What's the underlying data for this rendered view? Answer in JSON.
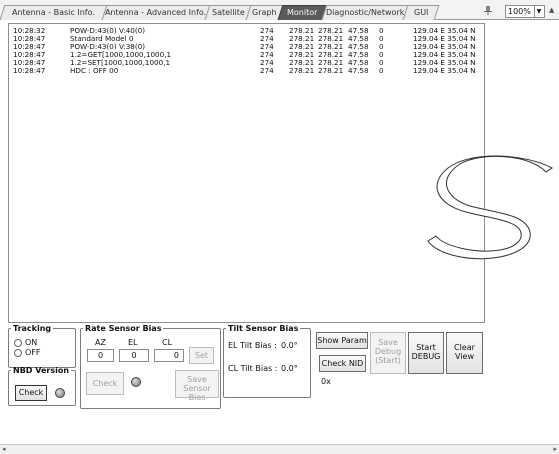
{
  "tabs": [
    {
      "label": "Antenna - Basic Info."
    },
    {
      "label": "Antenna - Advanced Info."
    },
    {
      "label": "Satellite"
    },
    {
      "label": "Graph"
    },
    {
      "label": "Monitor"
    },
    {
      "label": "Diagnostic/Network"
    },
    {
      "label": "GUI"
    }
  ],
  "active_tab": "Monitor",
  "zoom": {
    "value": "100%"
  },
  "log": [
    {
      "time": "10:28:32",
      "msg": "POW-D:43(0) V:40(0)",
      "c1": "274",
      "c2": "278.21",
      "c3": "278.21",
      "c4": "47.58",
      "c5": "0",
      "pos": "129.04 E 35.04 N"
    },
    {
      "time": "10:28:47",
      "msg": "Standard Model  0",
      "c1": "274",
      "c2": "278.21",
      "c3": "278.21",
      "c4": "47.58",
      "c5": "0",
      "pos": "129.04 E 35.04 N"
    },
    {
      "time": "10:28:47",
      "msg": "POW-D:43(0) V:38(0)",
      "c1": "274",
      "c2": "278.21",
      "c3": "278.21",
      "c4": "47.58",
      "c5": "0",
      "pos": "129.04 E 35.04 N"
    },
    {
      "time": "10:28:47",
      "msg": "1.2=GET[1000,1000,1000,1",
      "c1": "274",
      "c2": "278.21",
      "c3": "278.21",
      "c4": "47.58",
      "c5": "0",
      "pos": "129.04 E 35.04 N"
    },
    {
      "time": "10:28:47",
      "msg": "1.2=SET[1000,1000,1000,1",
      "c1": "274",
      "c2": "278.21",
      "c3": "278.21",
      "c4": "47.58",
      "c5": "0",
      "pos": "129.04 E 35.04 N"
    },
    {
      "time": "10:28:47",
      "msg": "HDC : OFF  00",
      "c1": "274",
      "c2": "278.21",
      "c3": "278.21",
      "c4": "47.58",
      "c5": "0",
      "pos": "129.04 E 35.04 N"
    }
  ],
  "tracking": {
    "title": "Tracking",
    "on": "ON",
    "off": "OFF"
  },
  "nbd": {
    "title": "NBD Version",
    "check": "Check"
  },
  "rate": {
    "title": "Rate Sensor Bias",
    "az": "AZ",
    "el": "EL",
    "cl": "CL",
    "az_val": "0",
    "el_val": "0",
    "cl_val": "0",
    "set": "Set",
    "check": "Check",
    "save_line1": "Save",
    "save_line2": "Sensor Bias"
  },
  "tilt": {
    "title": "Tilt Sensor Bias",
    "el_label": "EL Tilt Bias :",
    "el_val": "0.0°",
    "cl_label": "CL Tilt Bias :",
    "cl_val": "0.0°"
  },
  "buttons": {
    "show_param": "Show Param",
    "check_nid": "Check NID",
    "nid_value": "0x",
    "save_debug_1": "Save",
    "save_debug_2": "Debug",
    "save_debug_3": "(Start)",
    "start_debug_1": "Start",
    "start_debug_2": "DEBUG",
    "clear_view_1": "Clear",
    "clear_view_2": "View"
  }
}
